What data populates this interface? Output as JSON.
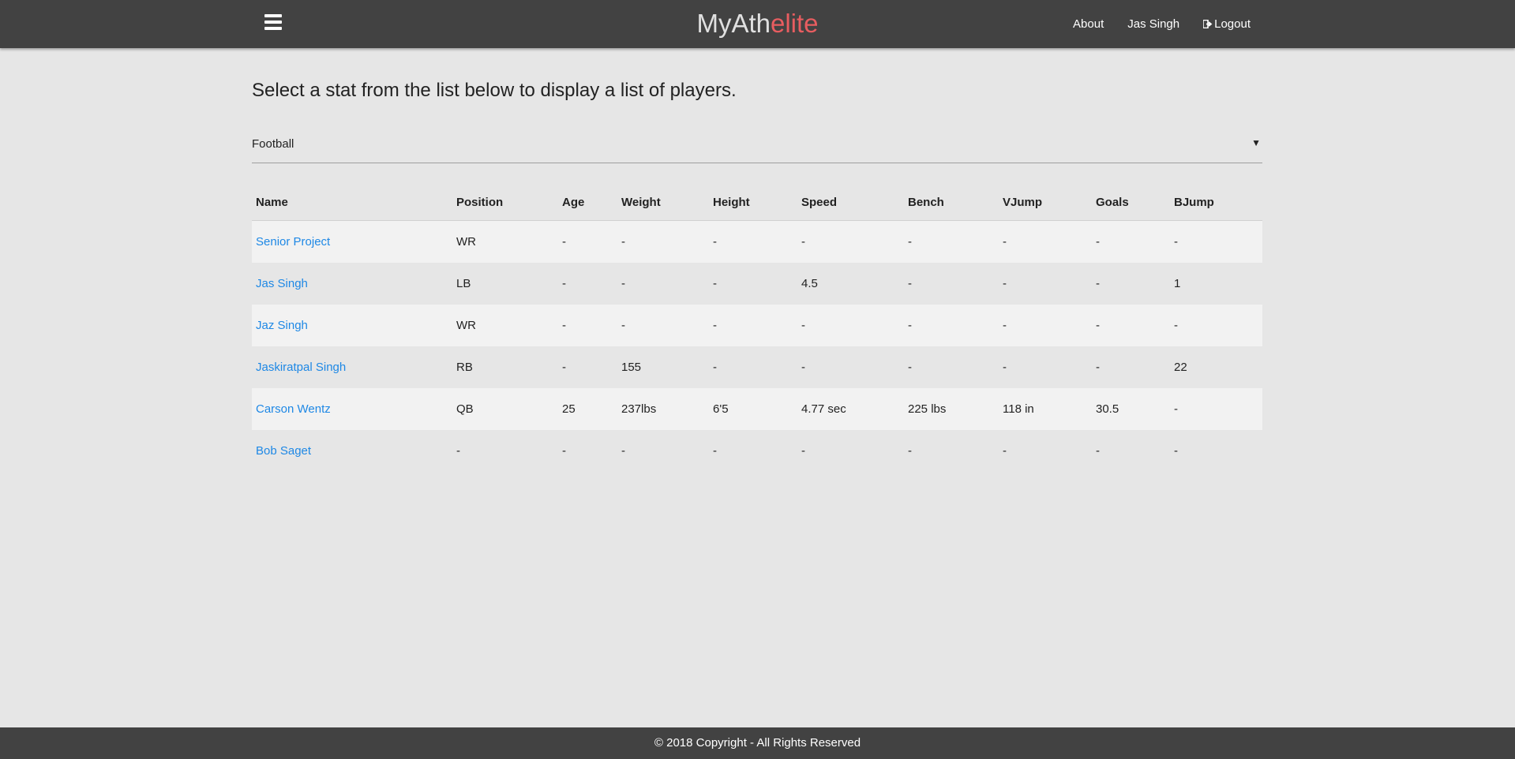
{
  "navbar": {
    "brand_part1": "MyAth",
    "brand_part2": "elite",
    "links": {
      "about": "About",
      "user": "Jas Singh",
      "logout": "Logout"
    }
  },
  "main": {
    "intro": "Select a stat from the list below to display a list of players.",
    "select": {
      "value": "Football",
      "caret": "▼"
    },
    "table": {
      "headers": [
        "Name",
        "Position",
        "Age",
        "Weight",
        "Height",
        "Speed",
        "Bench",
        "VJump",
        "Goals",
        "BJump"
      ],
      "rows": [
        [
          "Senior Project",
          "WR",
          "-",
          "-",
          "-",
          "-",
          "-",
          "-",
          "-",
          "-"
        ],
        [
          "Jas Singh",
          "LB",
          "-",
          "-",
          "-",
          "4.5",
          "-",
          "-",
          "-",
          "1"
        ],
        [
          "Jaz Singh",
          "WR",
          "-",
          "-",
          "-",
          "-",
          "-",
          "-",
          "-",
          "-"
        ],
        [
          "Jaskiratpal Singh",
          "RB",
          "-",
          "155",
          "-",
          "-",
          "-",
          "-",
          "-",
          "22"
        ],
        [
          "Carson Wentz",
          "QB",
          "25",
          "237lbs",
          "6'5",
          "4.77 sec",
          "225 lbs",
          "118 in",
          "30.5",
          "-"
        ],
        [
          "Bob Saget",
          "-",
          "-",
          "-",
          "-",
          "-",
          "-",
          "-",
          "-",
          "-"
        ]
      ]
    }
  },
  "footer": {
    "text": "© 2018 Copyright - All Rights Reserved"
  },
  "colors": {
    "navbar": "#424242",
    "background": "#e6e6e6",
    "brand_accent": "#e85d60",
    "link": "#1e88e5"
  },
  "icons": {
    "menu": "hamburger-menu-icon",
    "logout": "logout-icon",
    "caret": "caret-down-icon"
  }
}
